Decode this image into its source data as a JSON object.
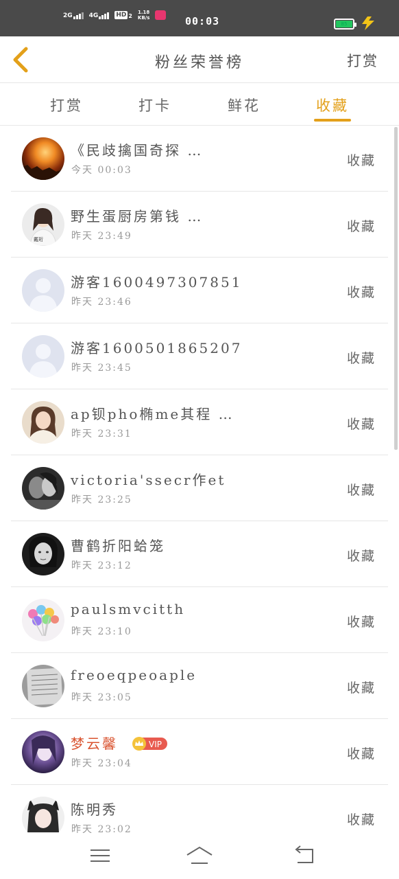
{
  "status_bar": {
    "sig1_label": "2G",
    "sig2_label": "4G",
    "hd_label": "HD",
    "hd_sub": "2",
    "speed": "1.18",
    "speed_unit": "KB/s",
    "time": "00:03",
    "battery_label": "85"
  },
  "header": {
    "title": "粉丝荣誉榜",
    "action": "打赏"
  },
  "tabs": [
    {
      "label": "打赏"
    },
    {
      "label": "打卡"
    },
    {
      "label": "鲜花"
    },
    {
      "label": "收藏"
    }
  ],
  "active_tab": "收藏",
  "list": [
    {
      "name": "《民歧擒国奇探 …",
      "time": "今天 00:03",
      "action": "收藏",
      "avatar": "fire-landscape"
    },
    {
      "name": "野生蛋厨房第钱 …",
      "time": "昨天 23:49",
      "action": "收藏",
      "avatar": "woman-white"
    },
    {
      "name": "游客1600497307851",
      "time": "昨天 23:46",
      "action": "收藏",
      "avatar": "default-avatar"
    },
    {
      "name": "游客1600501865207",
      "time": "昨天 23:45",
      "action": "收藏",
      "avatar": "default-avatar"
    },
    {
      "name": "ap钡pho椭me其程 …",
      "time": "昨天 23:31",
      "action": "收藏",
      "avatar": "girl-cream"
    },
    {
      "name": "victoria'ssecr作et",
      "time": "昨天 23:25",
      "action": "收藏",
      "avatar": "bw-couple"
    },
    {
      "name": "曹鹤折阳蛤笼",
      "time": "昨天 23:12",
      "action": "收藏",
      "avatar": "bw-portrait"
    },
    {
      "name": "paulsmvcitth",
      "time": "昨天 23:10",
      "action": "收藏",
      "avatar": "lollipops"
    },
    {
      "name": "freoeqpeoaple",
      "time": "昨天 23:05",
      "action": "收藏",
      "avatar": "paper"
    },
    {
      "name": "梦云馨",
      "time": "昨天 23:04",
      "action": "收藏",
      "avatar": "purple-portrait",
      "vip": "VIP"
    },
    {
      "name": "陈明秀",
      "time": "昨天 23:02",
      "action": "收藏",
      "avatar": "cat-girl"
    }
  ],
  "colors": {
    "accent": "#e3a01a",
    "vip_name": "#d9532f",
    "status_bar_bg": "#4a4a4a",
    "battery": "#22c55e"
  },
  "nav_icons": [
    "menu-icon",
    "home-icon",
    "back-icon"
  ]
}
